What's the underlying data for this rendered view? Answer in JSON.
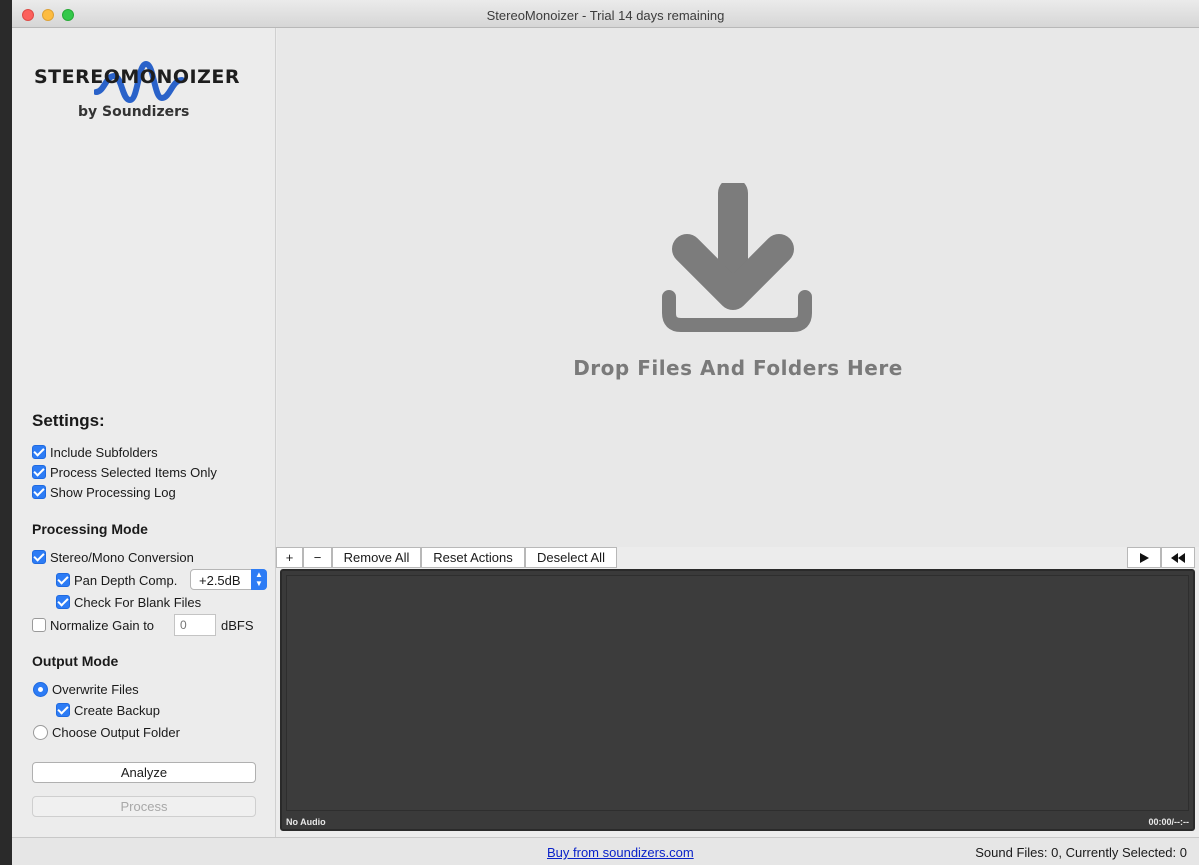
{
  "window": {
    "title": "StereoMonoizer - Trial 14 days remaining"
  },
  "logo": {
    "text": "STEREOMONOIZER",
    "sub": "by Soundizers"
  },
  "settings": {
    "title": "Settings:",
    "include_subfolders": {
      "label": "Include Subfolders",
      "checked": true
    },
    "process_selected": {
      "label": "Process Selected Items Only",
      "checked": true
    },
    "show_log": {
      "label": "Show Processing Log",
      "checked": true
    }
  },
  "processing_mode": {
    "title": "Processing Mode",
    "stereo_mono": {
      "label": "Stereo/Mono Conversion",
      "checked": true
    },
    "pan_depth": {
      "label": "Pan Depth Comp.",
      "checked": true,
      "value": "+2.5dB"
    },
    "check_blank": {
      "label": "Check For Blank Files",
      "checked": true
    },
    "normalize": {
      "label": "Normalize Gain to",
      "checked": false,
      "placeholder": "0",
      "unit": "dBFS"
    }
  },
  "output_mode": {
    "title": "Output Mode",
    "overwrite": {
      "label": "Overwrite Files",
      "selected": true
    },
    "create_backup": {
      "label": "Create Backup",
      "checked": true
    },
    "choose_folder": {
      "label": "Choose Output Folder",
      "selected": false
    }
  },
  "actions": {
    "analyze": "Analyze",
    "process": "Process"
  },
  "dropzone": {
    "text": "Drop Files And Folders Here",
    "icon": "download-icon"
  },
  "toolbar": {
    "add": "+",
    "remove": "−",
    "remove_all": "Remove All",
    "reset_actions": "Reset Actions",
    "deselect_all": "Deselect All",
    "play_icon": "play-icon",
    "rewind_icon": "rewind-icon"
  },
  "player": {
    "status": "No Audio",
    "time": "00:00/--:--"
  },
  "statusbar": {
    "buy_link": "Buy from soundizers.com",
    "status": "Sound Files: 0, Currently Selected: 0"
  },
  "colors": {
    "accent": "#2d7cf5",
    "link": "#0a22c9",
    "logo_wave": "#2a62c9",
    "drop_icon": "#7c7c7c"
  }
}
